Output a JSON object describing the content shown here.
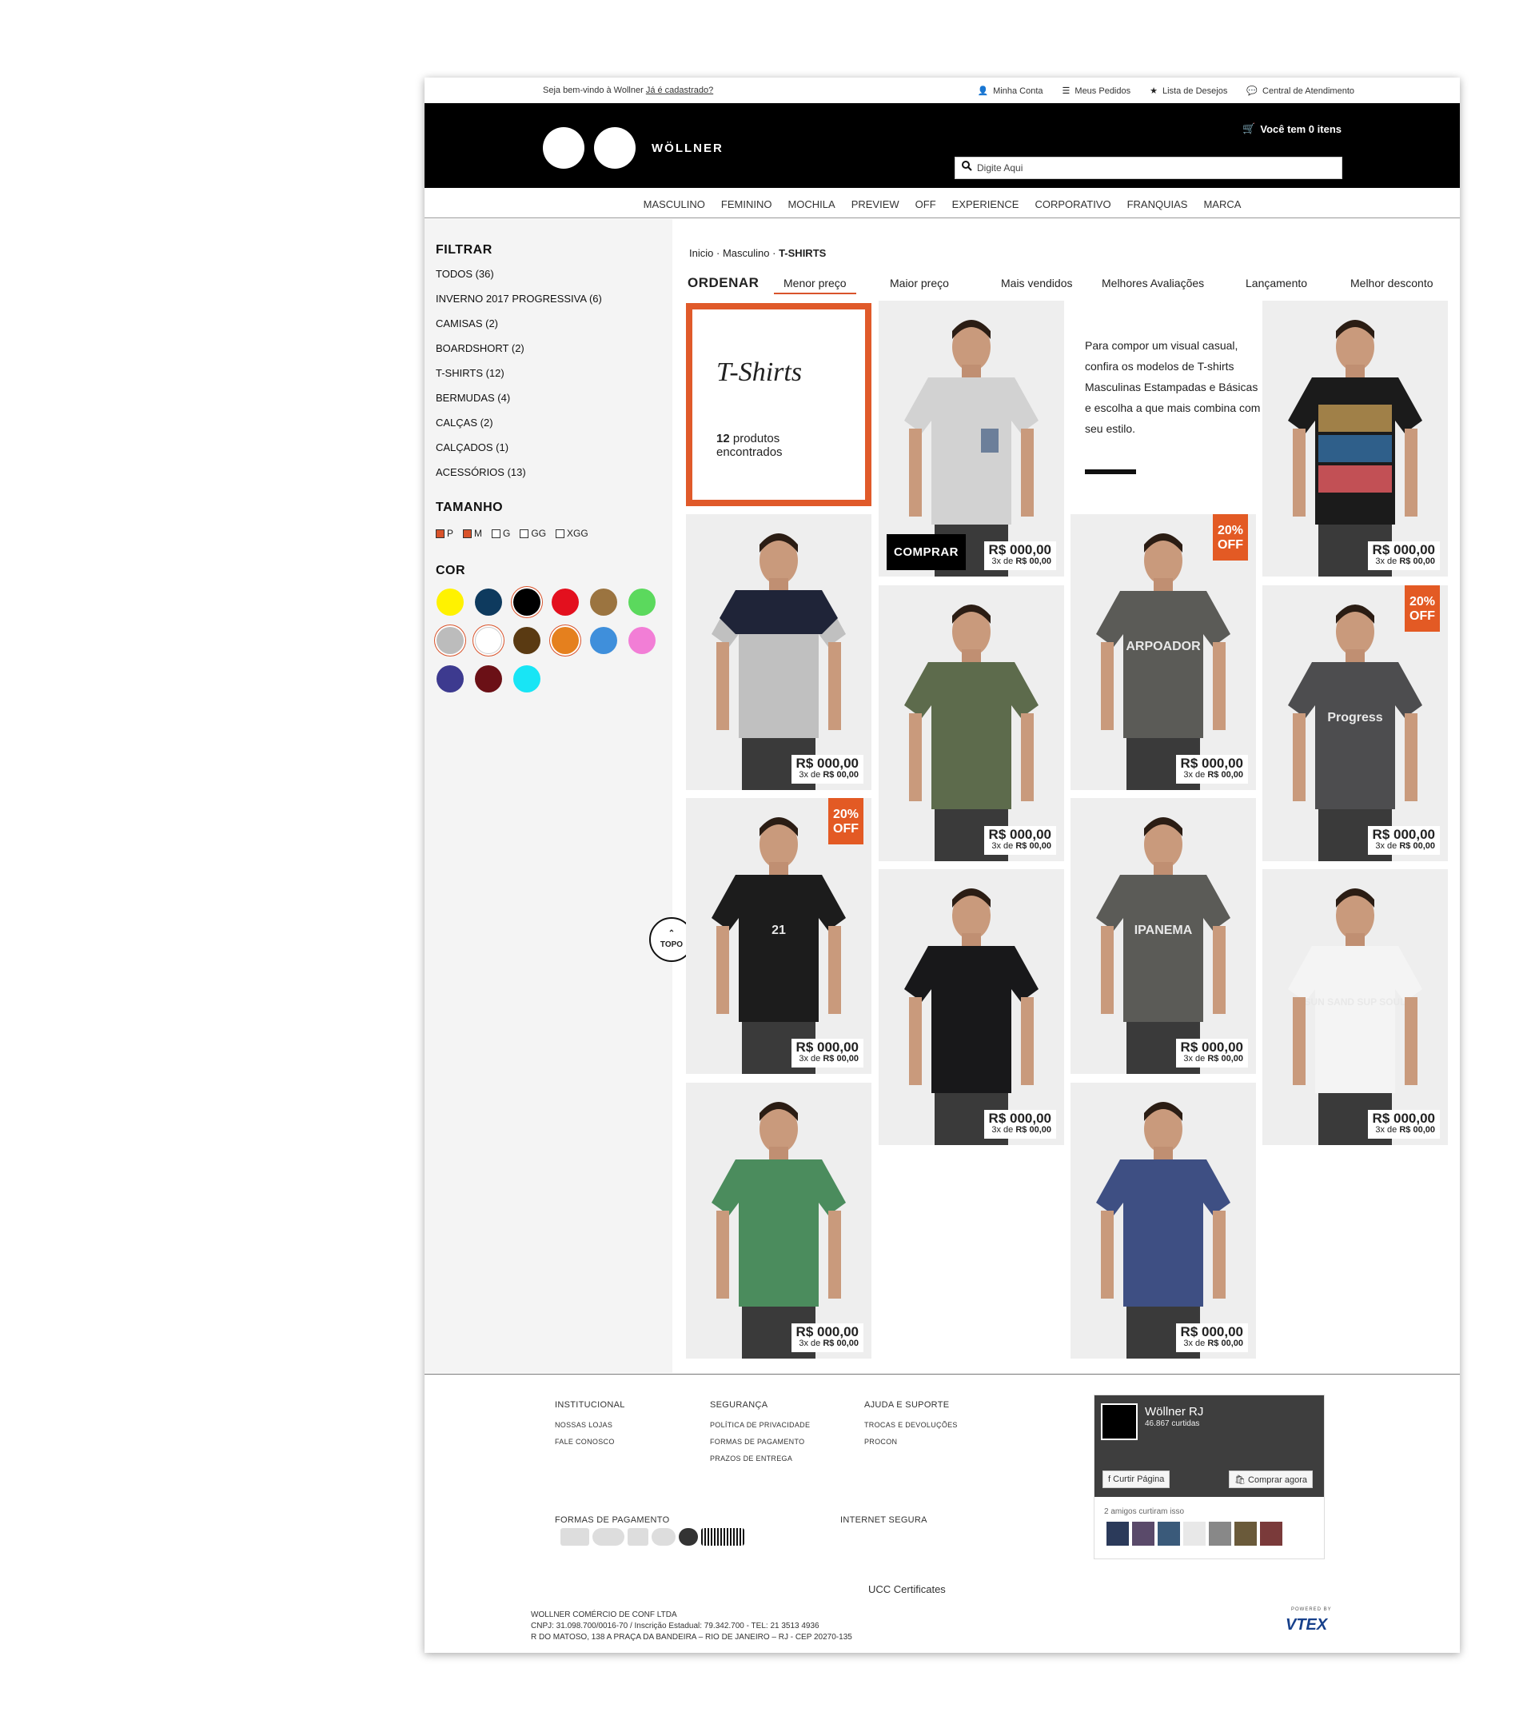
{
  "topbar": {
    "welcome": "Seja bem-vindo à Wollner",
    "signup": "Já é cadastrado?",
    "account": "Minha Conta",
    "orders": "Meus Pedidos",
    "wishlist": "Lista de Desejos",
    "support": "Central de Atendimento"
  },
  "header": {
    "brand": "WÖLLNER",
    "cart": "Você tem 0 itens",
    "search_placeholder": "Digite Aqui"
  },
  "nav": [
    "MASCULINO",
    "FEMININO",
    "MOCHILA",
    "PREVIEW",
    "OFF",
    "EXPERIENCE",
    "CORPORATIVO",
    "FRANQUIAS",
    "MARCA"
  ],
  "sidebar": {
    "filter_title": "FILTRAR",
    "filters": [
      "TODOS (36)",
      "INVERNO 2017 PROGRESSIVA (6)",
      "CAMISAS (2)",
      "BOARDSHORT (2)",
      "T-SHIRTS (12)",
      "BERMUDAS (4)",
      "CALÇAS (2)",
      "CALÇADOS (1)",
      "ACESSÓRIOS (13)"
    ],
    "size_title": "TAMANHO",
    "sizes": [
      {
        "label": "P",
        "checked": true
      },
      {
        "label": "M",
        "checked": true
      },
      {
        "label": "G",
        "checked": false
      },
      {
        "label": "GG",
        "checked": false
      },
      {
        "label": "XGG",
        "checked": false
      }
    ],
    "color_title": "COR",
    "colors": [
      "#fff200",
      "#0e3a5e",
      "#000000",
      "#e3101e",
      "#9b7440",
      "#5bd95d",
      "#bcbcbc",
      "#ffffff",
      "#5a3a12",
      "#e5801e",
      "#3f8fdb",
      "#f27ed6",
      "#3d3a8f",
      "#6b1016",
      "#18e5f5"
    ],
    "selected_colors": [
      "#000000",
      "#bcbcbc",
      "#ffffff",
      "#e5801e"
    ],
    "topo": "TOPO"
  },
  "breadcrumb": {
    "home": "Inicio",
    "sep": "·",
    "cat": "Masculino",
    "current": "T-SHIRTS"
  },
  "sort": {
    "label": "ORDENAR",
    "options": [
      "Menor preço",
      "Maior preço",
      "Mais vendidos",
      "Melhores Avaliações",
      "Lançamento",
      "Melhor desconto"
    ],
    "active": "Menor preço"
  },
  "category": {
    "title": "T-Shirts",
    "count_num": "12",
    "count_text": "produtos",
    "count_text2": "encontrados",
    "description": "Para compor um visual casual, confira os modelos de T-shirts Masculinas Estampadas e Básicas e escolha a que mais combina com seu estilo."
  },
  "product": {
    "price": "R$ 000,00",
    "installments_prefix": "3x de",
    "installments_value": "R$ 00,00",
    "buy": "COMPRAR",
    "off_percent": "20%",
    "off_label": "OFF"
  },
  "products": [
    {
      "id": "p1",
      "shirt": "#d2d2d2",
      "pocket": "#6c7f9a",
      "off": false,
      "buy": true
    },
    {
      "id": "p2",
      "shirt": "#1b1b1b",
      "stripes": [
        "#a08048",
        "#2f5f8a",
        "#c25055"
      ],
      "off": false
    },
    {
      "id": "p3",
      "shirt": "#c0c0c0",
      "top": "#1f2438",
      "off": false
    },
    {
      "id": "p4",
      "shirt": "#5d6b4c",
      "off": false
    },
    {
      "id": "p5",
      "shirt": "#5b5b57",
      "print": "ARPOADOR",
      "off": true
    },
    {
      "id": "p6",
      "shirt": "#4d4d4f",
      "print": "Progress",
      "off": true
    },
    {
      "id": "p7",
      "shirt": "#1c1c1c",
      "print": "21",
      "off": true
    },
    {
      "id": "p8",
      "shirt": "#18181a",
      "off": false
    },
    {
      "id": "p9",
      "shirt": "#5b5b57",
      "print": "IPANEMA",
      "off": false
    },
    {
      "id": "p10",
      "shirt": "#f4f4f4",
      "print": "SUN SAND SUP SOUL",
      "off": false
    },
    {
      "id": "p11",
      "shirt": "#4b8c5d",
      "off": false
    },
    {
      "id": "p12",
      "shirt": "#3e4f83",
      "off": false
    }
  ],
  "footer": {
    "institucional": {
      "title": "INSTITUCIONAL",
      "links": [
        "NOSSAS LOJAS",
        "FALE CONOSCO"
      ]
    },
    "seguranca": {
      "title": "SEGURANÇA",
      "links": [
        "POLÍTICA DE PRIVACIDADE",
        "FORMAS DE PAGAMENTO",
        "PRAZOS DE ENTREGA"
      ]
    },
    "ajuda": {
      "title": "AJUDA E SUPORTE",
      "links": [
        "TROCAS E DEVOLUÇÕES",
        "PROCON"
      ]
    },
    "payments_title": "FORMAS DE PAGAMENTO",
    "secure_title": "INTERNET SEGURA",
    "ucc": "UCC Certificates",
    "company": "WOLLNER COMÉRCIO DE CONF LTDA",
    "cnpj": "CNPJ: 31.098.700/0016-70 / Inscrição Estadual: 79.342.700 - TEL: 21 3513 4936",
    "address": "R DO MATOSO, 138 A PRAÇA DA BANDEIRA – RIO DE JANEIRO – RJ - CEP 20270-135",
    "vtex": "VTEX",
    "powered": "POWERED BY"
  },
  "facebook": {
    "page": "Wöllner RJ",
    "likes": "46.867 curtidas",
    "like_btn": "Curtir Página",
    "buy_btn": "Comprar agora",
    "friends": "2 amigos curtiram isso"
  }
}
